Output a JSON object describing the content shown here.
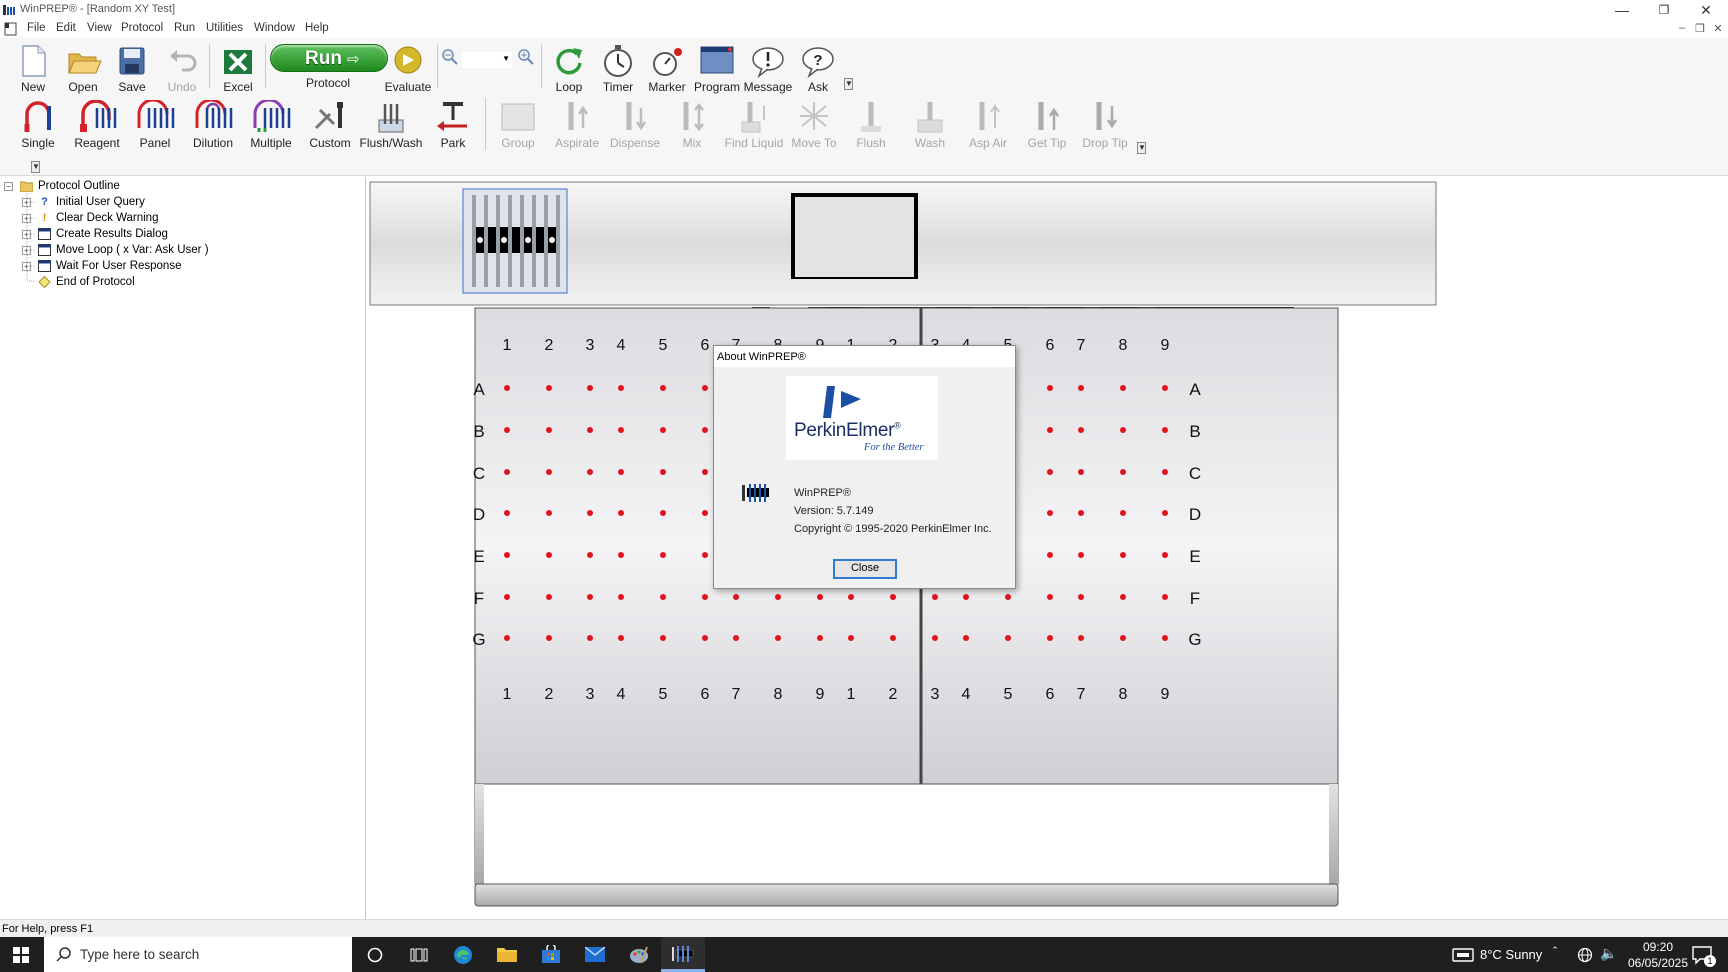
{
  "window": {
    "title": "WinPREP® - [Random XY Test]"
  },
  "menu": [
    "File",
    "Edit",
    "View",
    "Protocol",
    "Run",
    "Utilities",
    "Window",
    "Help"
  ],
  "toolbar1": {
    "new": "New",
    "open": "Open",
    "save": "Save",
    "undo": "Undo",
    "excel": "Excel",
    "run_button": "Run",
    "protocol": "Protocol",
    "evaluate": "Evaluate",
    "loop": "Loop",
    "timer": "Timer",
    "marker": "Marker",
    "program": "Program",
    "message": "Message",
    "ask": "Ask"
  },
  "toolbar2": [
    "Single",
    "Reagent",
    "Panel",
    "Dilution",
    "Multiple",
    "Custom",
    "Flush/Wash",
    "Park"
  ],
  "toolbar2_disabled": [
    "Group",
    "Aspirate",
    "Dispense",
    "Mix",
    "Find Liquid",
    "Move To",
    "Flush",
    "Wash",
    "Asp Air",
    "Get Tip",
    "Drop Tip"
  ],
  "outline": {
    "root": "Protocol Outline",
    "items": [
      "Initial User Query",
      "Clear Deck Warning",
      "Create Results Dialog",
      "Move Loop ( x Var: Ask User )",
      "Wait For User Response",
      "End of Protocol"
    ]
  },
  "deck": {
    "columns": [
      "1",
      "2",
      "3",
      "4",
      "5",
      "6",
      "7",
      "8",
      "9"
    ],
    "rows": [
      "A",
      "B",
      "C",
      "D",
      "E",
      "F",
      "G"
    ],
    "well_color": "#e0141e"
  },
  "dialog": {
    "title": "About WinPREP®",
    "brand": "PerkinElmer",
    "brand_suffix": "®",
    "tagline": "For the Better",
    "product": "WinPREP®",
    "version": "Version:  5.7.149",
    "copyright": "Copyright © 1995-2020  PerkinElmer Inc.",
    "close": "Close"
  },
  "status": {
    "text": "For Help, press F1"
  },
  "taskbar": {
    "search_placeholder": "Type here to search",
    "weather": "8°C  Sunny",
    "time": "09:20",
    "date": "06/05/2025",
    "notifications": "1"
  }
}
